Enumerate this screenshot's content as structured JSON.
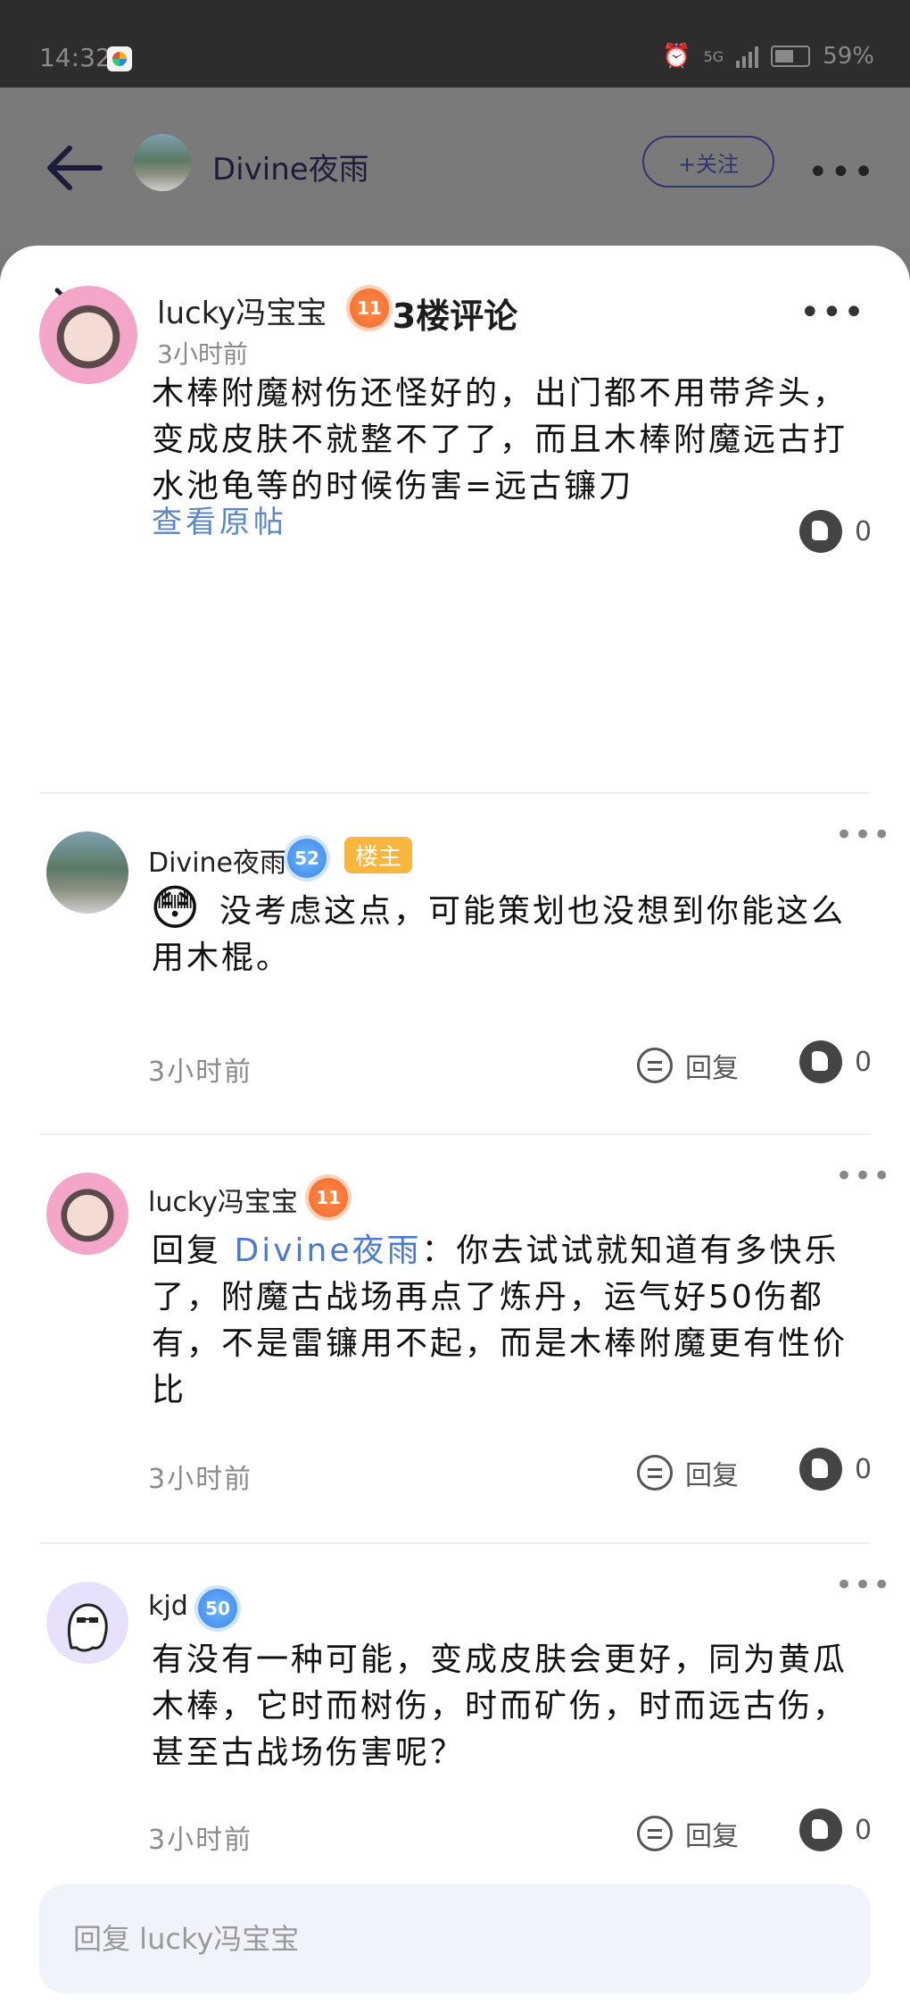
{
  "status_bar": {
    "time": "14:32",
    "network": "5G",
    "battery": "59%"
  },
  "header": {
    "author_name": "Divine夜雨",
    "follow_label": "+关注",
    "more_glyph": "•••"
  },
  "sheet": {
    "title": "3楼评论",
    "more_glyph": "•••"
  },
  "main_comment": {
    "user": "lucky冯宝宝",
    "level": "11",
    "time": "3小时前",
    "text": "木棒附魔树伤还怪好的，出门都不用带斧头，变成皮肤不就整不了了，而且木棒附魔远古打水池龟等的时候伤害=远古镰刀",
    "view_original": "查看原帖",
    "likes": "0"
  },
  "replies": [
    {
      "user": "Divine夜雨",
      "level": "52",
      "badge": "楼主",
      "text": "没考虑这点，可能策划也没想到你能这么用木棍。",
      "time": "3小时前",
      "reply_label": "回复",
      "likes": "0"
    },
    {
      "user": "lucky冯宝宝",
      "level": "11",
      "reply_prefix": "回复",
      "reply_to": "Divine夜雨",
      "text": "：你去试试就知道有多快乐了，附魔古战场再点了炼丹，运气好50伤都有，不是雷镰用不起，而是木棒附魔更有性价比",
      "time": "3小时前",
      "reply_label": "回复",
      "likes": "0"
    },
    {
      "user": "kjd",
      "level": "50",
      "text": "有没有一种可能，变成皮肤会更好，同为黄瓜木棒，它时而树伤，时而矿伤，时而远古伤，甚至古战场伤害呢？",
      "time": "3小时前",
      "reply_label": "回复",
      "likes": "0"
    }
  ],
  "reply_input": {
    "placeholder": "回复 lucky冯宝宝"
  }
}
